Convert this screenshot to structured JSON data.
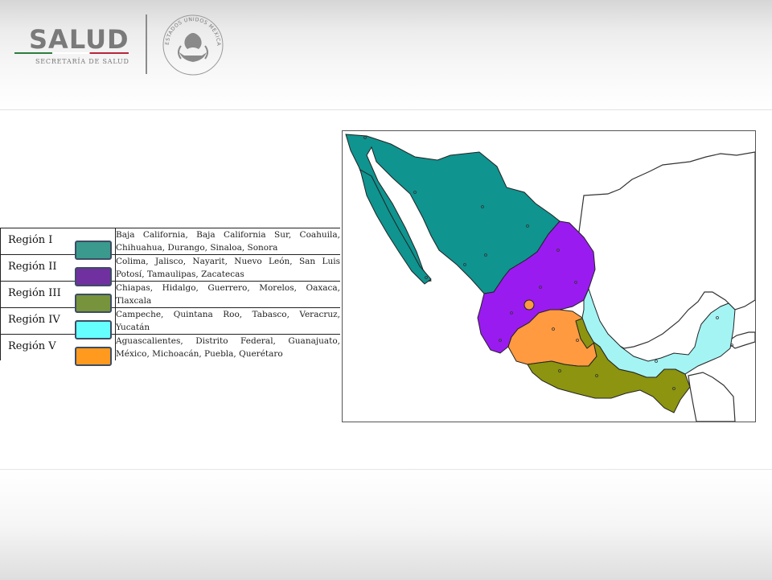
{
  "header": {
    "logo_text": "SALUD",
    "logo_subtitle": "SECRETARÍA DE SALUD",
    "seal_text": "ESTADOS UNIDOS MEXICANOS"
  },
  "colors": {
    "region_1": "#3a9a8e",
    "region_2": "#7030a0",
    "region_3": "#77933c",
    "region_4": "#66ffff",
    "region_5": "#ff9a1f",
    "map_region_1": "#0f9490",
    "map_region_2": "#9a1bf0",
    "map_region_3": "#8c9410",
    "map_region_4": "#a4f4f4",
    "map_region_5": "#ff9a40"
  },
  "legend": [
    {
      "region": "Región I",
      "states": "Baja California, Baja California Sur, Coahuila, Chihuahua, Durango, Sinaloa, Sonora"
    },
    {
      "region": "Región II",
      "states": "Colima, Jalisco, Nayarit, Nuevo León, San Luis Potosí, Tamaulipas, Zacatecas"
    },
    {
      "region": "Región III",
      "states": "Chiapas, Hidalgo, Guerrero, Morelos, Oaxaca, Tlaxcala"
    },
    {
      "region": "Región IV",
      "states": "Campeche, Quintana Roo, Tabasco, Veracruz, Yucatán"
    },
    {
      "region": "Región V",
      "states": "Aguascalientes, Distrito Federal, Guanajuato, México, Michoacán, Puebla, Querétaro"
    }
  ]
}
